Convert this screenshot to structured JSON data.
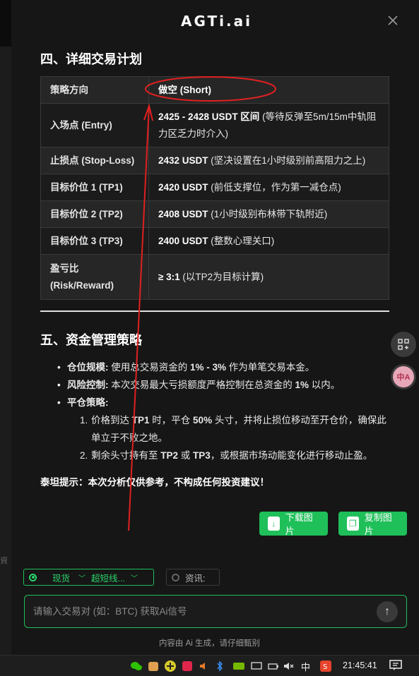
{
  "app": {
    "logo": "AGTi.ai",
    "close_label": "✕"
  },
  "plan": {
    "heading": "四、详细交易计划",
    "rows": [
      {
        "key": "策略方向",
        "bold": "做空 (Short)",
        "rest": ""
      },
      {
        "key": "入场点 (Entry)",
        "bold": "2425 - 2428 USDT 区间",
        "rest": " (等待反弹至5m/15m中轨阻力区乏力时介入)"
      },
      {
        "key": "止损点 (Stop-Loss)",
        "bold": "2432 USDT",
        "rest": " (坚决设置在1小时级别前高阻力之上)"
      },
      {
        "key": "目标价位 1 (TP1)",
        "bold": "2420 USDT",
        "rest": " (前低支撑位，作为第一减仓点)"
      },
      {
        "key": "目标价位 2 (TP2)",
        "bold": "2408 USDT",
        "rest": " (1小时级别布林带下轨附近)"
      },
      {
        "key": "目标价位 3 (TP3)",
        "bold": "2400 USDT",
        "rest": " (整数心理关口)"
      },
      {
        "key": "盈亏比 (Risk/Reward)",
        "bold": "≥ 3:1",
        "rest": " (以TP2为目标计算)"
      }
    ]
  },
  "money": {
    "heading": "五、资金管理策略",
    "items": [
      {
        "label": "仓位规模:",
        "text_a": " 使用总交易资金的 ",
        "b1": "1% - 3%",
        "text_b": " 作为单笔交易本金。"
      },
      {
        "label": "风险控制:",
        "text_a": " 本次交易最大亏损额度严格控制在总资金的 ",
        "b1": "1%",
        "text_b": " 以内。"
      },
      {
        "label": "平仓策略:"
      }
    ],
    "sub": [
      {
        "num": "1.",
        "t1": "价格到达 ",
        "b1": "TP1",
        "t2": " 时，平仓 ",
        "b2": "50%",
        "t3": " 头寸，并将止损位移动至开仓价，确保此单立于不败之地。"
      },
      {
        "num": "2.",
        "t1": "剩余头寸持有至 ",
        "b1": "TP2",
        "t2": " 或 ",
        "b2": "TP3",
        "t3": "，或根据市场动能变化进行移动止盈。"
      }
    ],
    "disclaimer": "泰坦提示：本次分析仅供参考，不构成任何投资建议！"
  },
  "actions": {
    "download": "下载图片",
    "copy": "复制图片"
  },
  "floating": {
    "translate_label": "中A"
  },
  "controls": {
    "market": "现货",
    "type": "超短线...",
    "news": "资讯:",
    "input_placeholder": "请输入交易对 (如：BTC) 获取Ai信号",
    "send_icon": "↑",
    "footer": "内容由 Ai 生成，请仔细甄别"
  },
  "taskbar": {
    "lang": "中",
    "clock": "21:45:41"
  },
  "colors": {
    "accent": "#1fbf5a",
    "annotation": "#e02020"
  }
}
